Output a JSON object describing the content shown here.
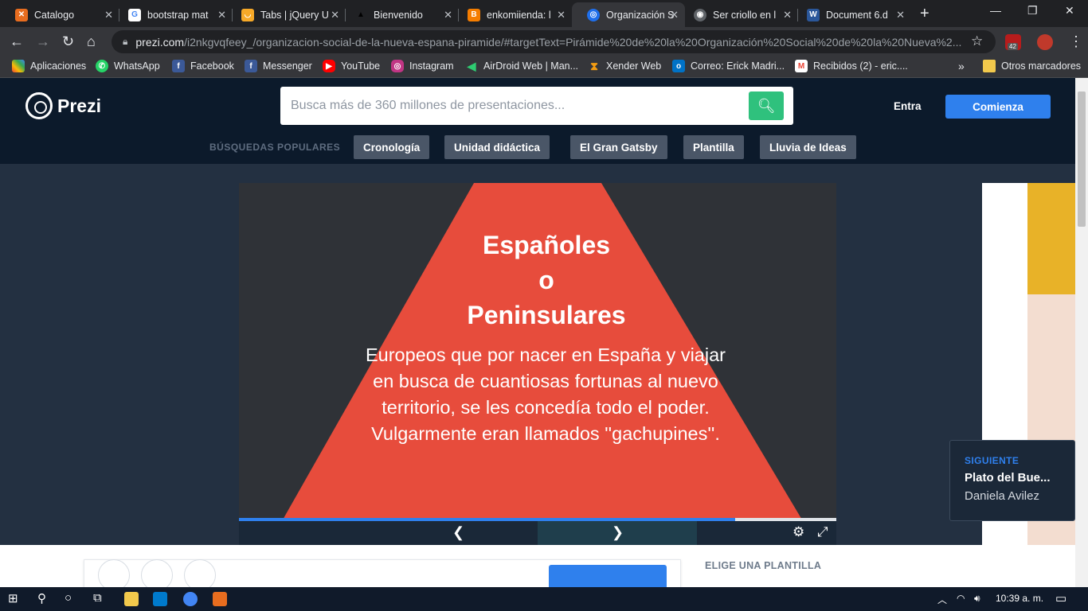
{
  "browser": {
    "tabs": [
      {
        "title": "Catalogo",
        "icon": "xampp-icon"
      },
      {
        "title": "bootstrap mat",
        "icon": "google-icon"
      },
      {
        "title": "Tabs | jQuery U",
        "icon": "jquery-icon"
      },
      {
        "title": "Bienvenido",
        "icon": "bat-icon"
      },
      {
        "title": "enkomiienda: l",
        "icon": "blogger-icon"
      },
      {
        "title": "Organización S",
        "icon": "prezi-icon"
      },
      {
        "title": "Ser criollo en l",
        "icon": "globe-icon"
      },
      {
        "title": "Document 6.d",
        "icon": "word-icon"
      }
    ],
    "active_tab": 5,
    "new_tab": "+",
    "address": {
      "host": "prezi.com",
      "path": "/i2nkgvqfeey_/organizacion-social-de-la-nueva-espana-piramide/#targetText=Pirámide%20de%20la%20Organización%20Social%20de%20la%20Nueva%2..."
    },
    "extension_badge": "42",
    "bookmarks": [
      {
        "label": "Aplicaciones",
        "icon": "apps-icon"
      },
      {
        "label": "WhatsApp",
        "icon": "whatsapp-icon"
      },
      {
        "label": "Facebook",
        "icon": "facebook-icon"
      },
      {
        "label": "Messenger",
        "icon": "facebook-icon"
      },
      {
        "label": "YouTube",
        "icon": "youtube-icon"
      },
      {
        "label": "Instagram",
        "icon": "instagram-icon"
      },
      {
        "label": "AirDroid Web | Man...",
        "icon": "airdroid-icon"
      },
      {
        "label": "Xender Web",
        "icon": "xender-icon"
      },
      {
        "label": "Correo: Erick Madri...",
        "icon": "outlook-icon"
      },
      {
        "label": "Recibidos (2) - eric....",
        "icon": "gmail-icon"
      }
    ],
    "bookmarks_more": "»",
    "other_bookmarks": "Otros marcadores"
  },
  "site": {
    "logo": "Prezi",
    "search_placeholder": "Busca más de 360 millones de presentaciones...",
    "login": "Entra",
    "signup": "Comienza",
    "popular_label": "BÚSQUEDAS POPULARES",
    "popular": [
      "Cronología",
      "Unidad didáctica",
      "El Gran Gatsby",
      "Plantilla",
      "Lluvia de Ideas"
    ]
  },
  "slide": {
    "title_lines": [
      "Españoles",
      "o",
      "Peninsulares"
    ],
    "body": "Europeos que por nacer en España y viajar en busca de cuantiosas fortunas al nuevo territorio, se les concedía todo el poder. Vulgarmente eran llamados ''gachupines''.",
    "progress": 0.83,
    "colors": {
      "triangle": "#e74c3c",
      "background": "#2f3237"
    }
  },
  "next": {
    "label": "SIGUIENTE",
    "title": "Plato del Bue...",
    "author": "Daniela Avilez"
  },
  "templates_label": "ELIGE UNA PLANTILLA",
  "taskbar": {
    "time": "10:39 a. m."
  }
}
